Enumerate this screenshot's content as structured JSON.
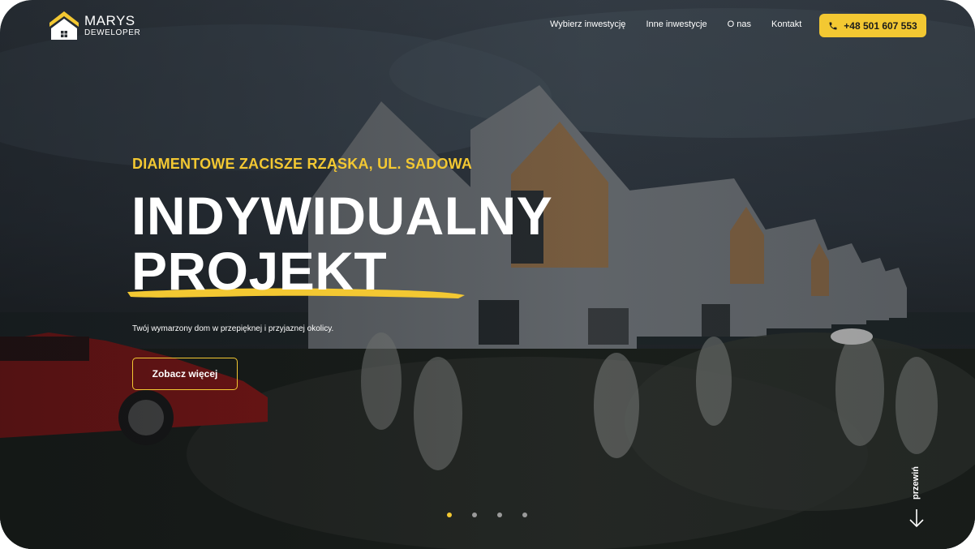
{
  "header": {
    "logo": {
      "name": "MARYS",
      "sub": "DEWELOPER"
    },
    "nav": [
      {
        "label": "Wybierz inwestycję"
      },
      {
        "label": "Inne inwestycje"
      },
      {
        "label": "O nas"
      },
      {
        "label": "Kontakt"
      }
    ],
    "phone": {
      "label": "+48 501 607 553",
      "icon": "phone-icon"
    }
  },
  "hero": {
    "eyebrow": "DIAMENTOWE ZACISZE RZĄSKA, UL. SADOWA",
    "headline_line1": "INDYWIDUALNY",
    "headline_line2": "PROJEKT",
    "subtitle": "Twój wymarzony dom w przepięknej i przyjaznej okolicy.",
    "cta": "Zobacz więcej"
  },
  "slider": {
    "count": 4,
    "active_index": 0
  },
  "scroll_hint": {
    "label": "przewiń",
    "icon": "arrow-down-icon"
  },
  "colors": {
    "accent": "#f3c832",
    "text": "#ffffff"
  }
}
